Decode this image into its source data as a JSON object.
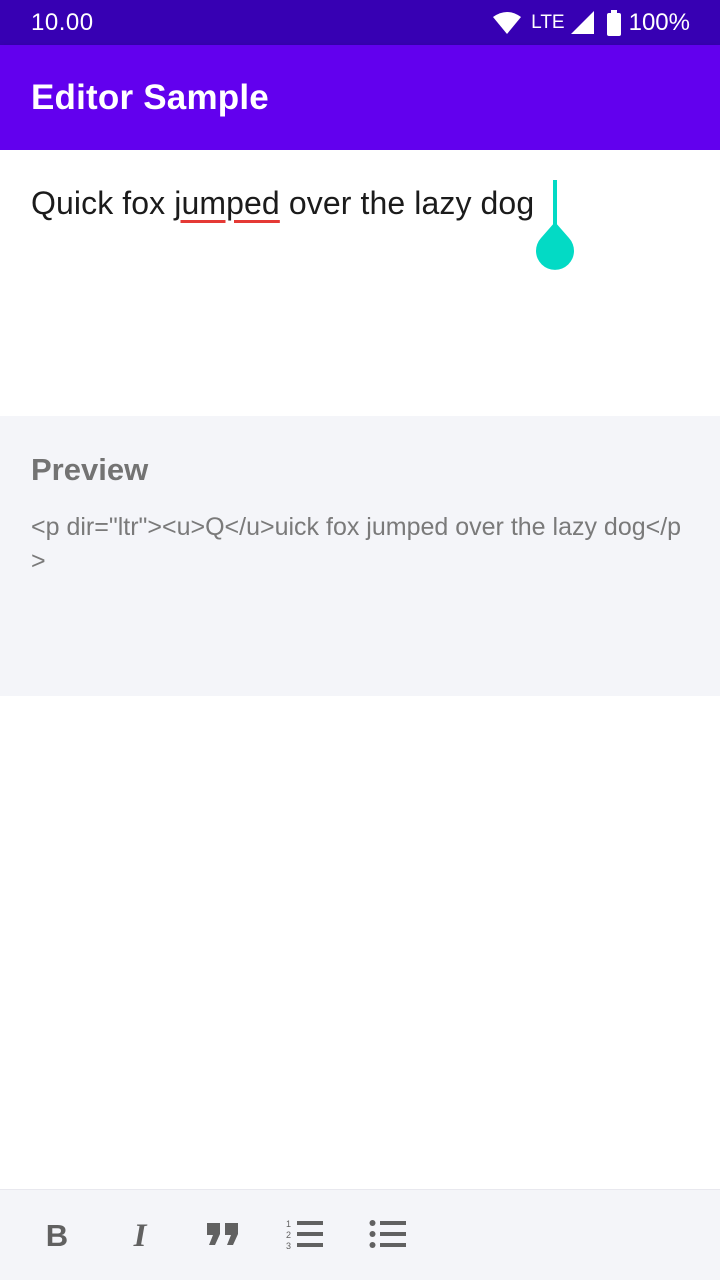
{
  "status_bar": {
    "time": "10.00",
    "network": "LTE",
    "battery": "100%",
    "icons": [
      "wifi-icon",
      "cellular-signal-icon",
      "battery-icon"
    ]
  },
  "app_bar": {
    "title": "Editor Sample",
    "color": "#6200ee"
  },
  "editor": {
    "text_before": "Quick fox ",
    "text_misspelled": "jumped",
    "text_after": " over the lazy dog",
    "cursor_color": "#03dac5",
    "spellcheck_color": "#e53935"
  },
  "preview": {
    "title": "Preview",
    "html": "<p dir=\"ltr\"><u>Q</u>uick fox jumped over the lazy dog</p>"
  },
  "toolbar": {
    "bold_label": "B",
    "italic_label": "I",
    "buttons": [
      "bold",
      "italic",
      "quote",
      "ordered-list",
      "bullet-list"
    ]
  }
}
